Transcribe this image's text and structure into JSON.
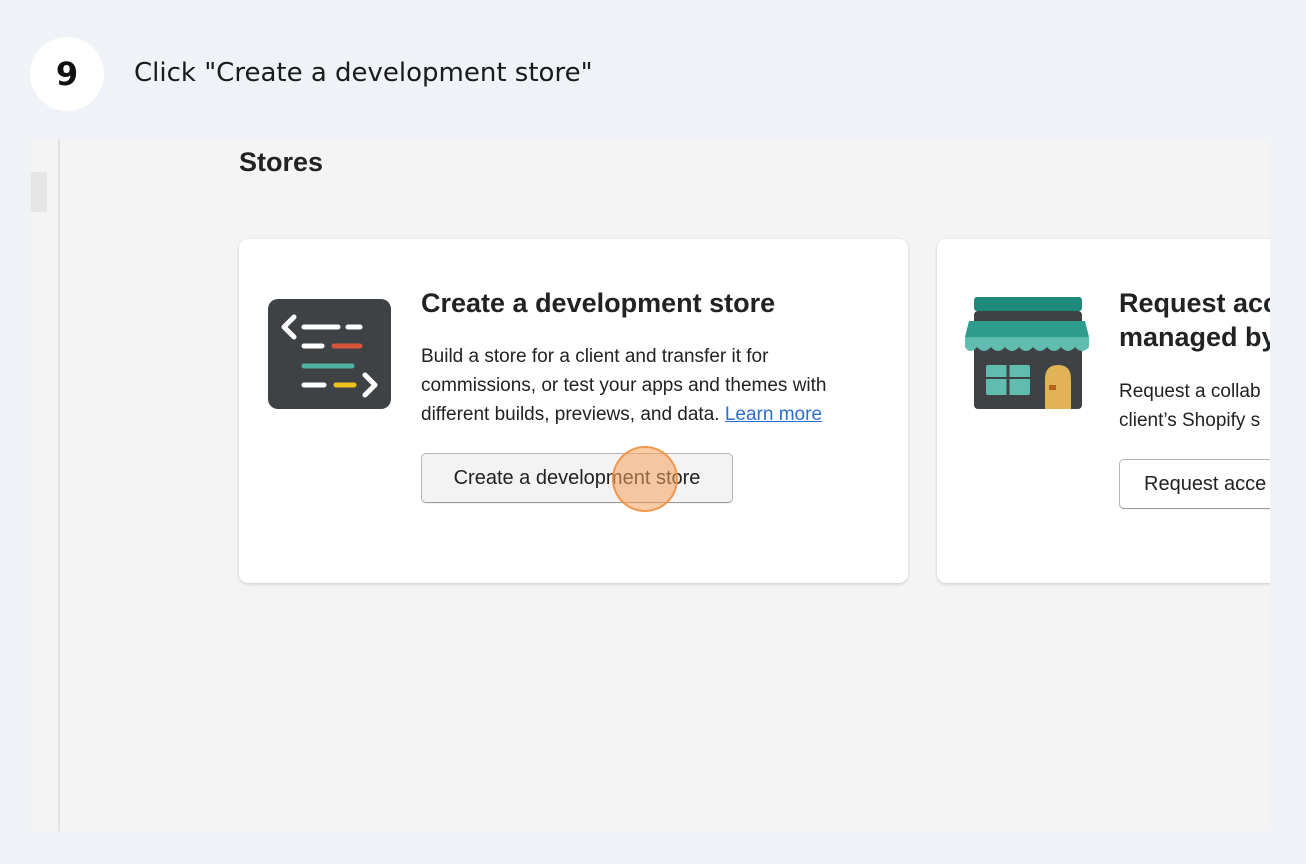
{
  "step": {
    "number": "9",
    "instruction": "Click \"Create a development store\""
  },
  "page": {
    "title": "Stores"
  },
  "cards": [
    {
      "icon": "code-editor-icon",
      "title": "Create a development store",
      "description": "Build a store for a client and transfer it for commissions, or test your apps and themes with different builds, previews, and data.",
      "link_text": "Learn more",
      "button_label": "Create a development store"
    },
    {
      "icon": "storefront-icon",
      "title_line1": "Request acc",
      "title_line2": "managed by",
      "desc_line1": "Request a collab",
      "desc_line2": "client’s Shopify s",
      "button_label": "Request acce"
    }
  ],
  "colors": {
    "background": "#eff2f7",
    "click_highlight": "#f5a05a",
    "link": "#2c6ecb"
  }
}
